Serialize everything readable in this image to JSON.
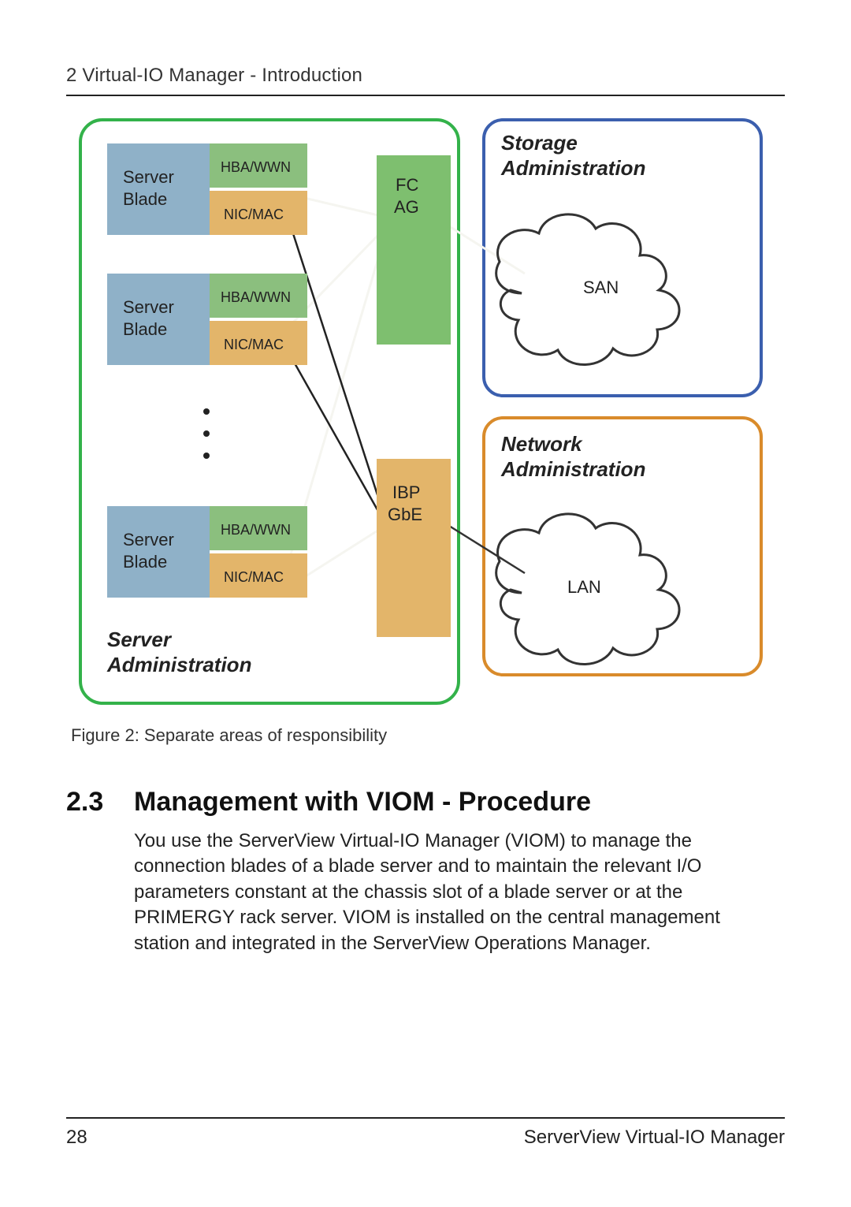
{
  "header": {
    "running_head": "2 Virtual-IO Manager - Introduction"
  },
  "figure": {
    "caption": "Figure 2: Separate areas of responsibility",
    "server_admin_label": "Server\nAdministration",
    "server_blade_label": "Server\nBlade",
    "hba_label": "HBA/WWN",
    "nic_label": "NIC/MAC",
    "fc_ag_label": "FC\nAG",
    "ibp_gbe_label": "IBP\nGbE",
    "storage_admin_label": "Storage\nAdministration",
    "network_admin_label": "Network\nAdministration",
    "san_label": "SAN",
    "lan_label": "LAN"
  },
  "section": {
    "number": "2.3",
    "title": "Management with VIOM - Procedure",
    "body": "You use the ServerView Virtual-IO Manager (VIOM) to manage the connection blades of a blade server and to maintain the relevant I/O parameters constant at the chassis slot of a blade server or at the PRIMERGY rack server. VIOM is installed on the central management station and integrated in the ServerView Operations Manager."
  },
  "footer": {
    "page_number": "28",
    "doc_title": "ServerView Virtual-IO Manager"
  },
  "colors": {
    "green_stroke": "#33b24a",
    "blue_stroke": "#3b5fae",
    "orange_stroke": "#d98b2b",
    "blue_fill": "#8fb1c8",
    "green_fill": "#8bbf7e",
    "orange_fill": "#e3b56a",
    "fc_green": "#7ebf6f",
    "cloud_stroke": "#333333"
  }
}
